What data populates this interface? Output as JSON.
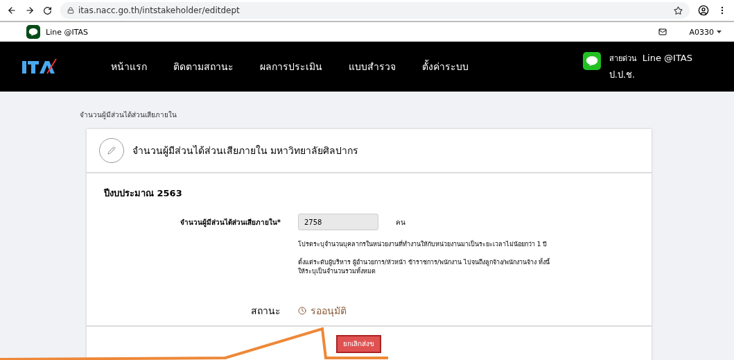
{
  "browser": {
    "url": "itas.nacc.go.th/intstakeholder/editdept"
  },
  "topbar": {
    "brand": "Line @ITAS",
    "user": "A0330"
  },
  "nav": {
    "items": [
      "หน้าแรก",
      "ติดตามสถานะ",
      "ผลการประเมิน",
      "แบบสำรวจ",
      "ตั้งค่าระบบ"
    ],
    "hotline_label": "สายด่วน",
    "hotline_name": "Line @ITAS",
    "hotline_org": "ป.ป.ช."
  },
  "breadcrumb": "จำนวนผู้มีส่วนได้ส่วนเสียภายใน",
  "card": {
    "title": "จำนวนผู้มีส่วนได้ส่วนเสียภายใน มหาวิทยาลัยศิลปากร",
    "year": "ปีงบประมาณ 2563",
    "field": {
      "label": "จำนวนผู้มีส่วนได้ส่วนเสียภายใน*",
      "value": "2758",
      "unit": "คน"
    },
    "help": [
      "โปรดระบุจำนวนบุคลากรในหน่วยงานที่ทำงานให้กับหน่วยงานมาเป็นระยะเวลาไม่น้อยกว่า 1 ปี",
      "ตั้งแต่ระดับผู้บริหาร ผู้อำนวยการ/หัวหน้า ข้าราชการ/พนักงาน ไปจนถึงลูกจ้าง/พนักงานจ้าง ทั้งนี้\nให้ระบุเป็นจำนวนรวมทั้งหมด"
    ],
    "status_label": "สถานะ",
    "status": "รออนุมัติ",
    "button": "ยกเลิกส่งข"
  }
}
